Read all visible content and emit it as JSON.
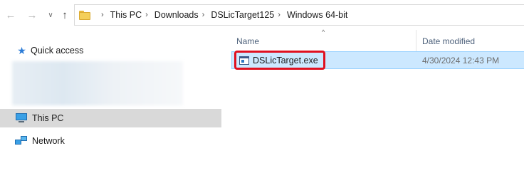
{
  "toolbar": {
    "back_icon": "arrow-left-icon",
    "forward_icon": "arrow-right-icon",
    "recent_icon": "chevron-down-icon",
    "up_icon": "arrow-up-icon"
  },
  "address_bar": {
    "breadcrumbs": [
      "This PC",
      "Downloads",
      "DSLicTarget125",
      "Windows 64-bit"
    ]
  },
  "navigation_pane": {
    "items": [
      {
        "label": "Quick access",
        "icon": "star-icon"
      },
      {
        "label": "This PC",
        "icon": "computer-icon",
        "selected": true
      },
      {
        "label": "Network",
        "icon": "network-icon"
      }
    ]
  },
  "file_list": {
    "columns": {
      "name": "Name",
      "date_modified": "Date modified"
    },
    "sort_indicator": "^",
    "files": [
      {
        "name": "DSLicTarget.exe",
        "date_modified": "4/30/2024 12:43 PM",
        "selected": true,
        "highlighted": true
      }
    ]
  },
  "colors": {
    "selection_bg": "#cce8ff",
    "highlight_border": "#e01020",
    "nav_selected_bg": "#d9d9d9"
  }
}
